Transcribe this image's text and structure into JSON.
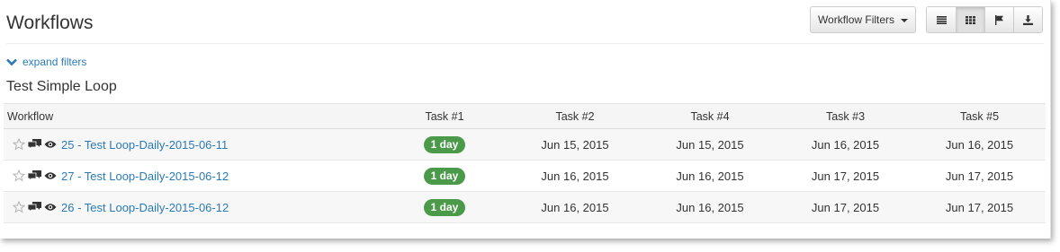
{
  "header": {
    "title": "Workflows",
    "filters_button": "Workflow Filters",
    "view_buttons": [
      "list-view",
      "grid-view",
      "flag-view",
      "download"
    ]
  },
  "filters": {
    "expand_label": "expand filters"
  },
  "section": {
    "title": "Test Simple Loop"
  },
  "table": {
    "columns": [
      "Workflow",
      "Task #1",
      "Task #2",
      "Task #4",
      "Task #3",
      "Task #5"
    ],
    "rows": [
      {
        "workflow": "25 - Test Loop-Daily-2015-06-11",
        "task1": "1 day",
        "task2": "Jun 15, 2015",
        "task4": "Jun 15, 2015",
        "task3": "Jun 16, 2015",
        "task5": "Jun 16, 2015"
      },
      {
        "workflow": "27 - Test Loop-Daily-2015-06-12",
        "task1": "1 day",
        "task2": "Jun 16, 2015",
        "task4": "Jun 16, 2015",
        "task3": "Jun 17, 2015",
        "task5": "Jun 17, 2015"
      },
      {
        "workflow": "26 - Test Loop-Daily-2015-06-12",
        "task1": "1 day",
        "task2": "Jun 16, 2015",
        "task4": "Jun 16, 2015",
        "task3": "Jun 17, 2015",
        "task5": "Jun 17, 2015"
      }
    ]
  },
  "colors": {
    "link": "#2a7ab8",
    "badge": "#4a9a4a"
  }
}
